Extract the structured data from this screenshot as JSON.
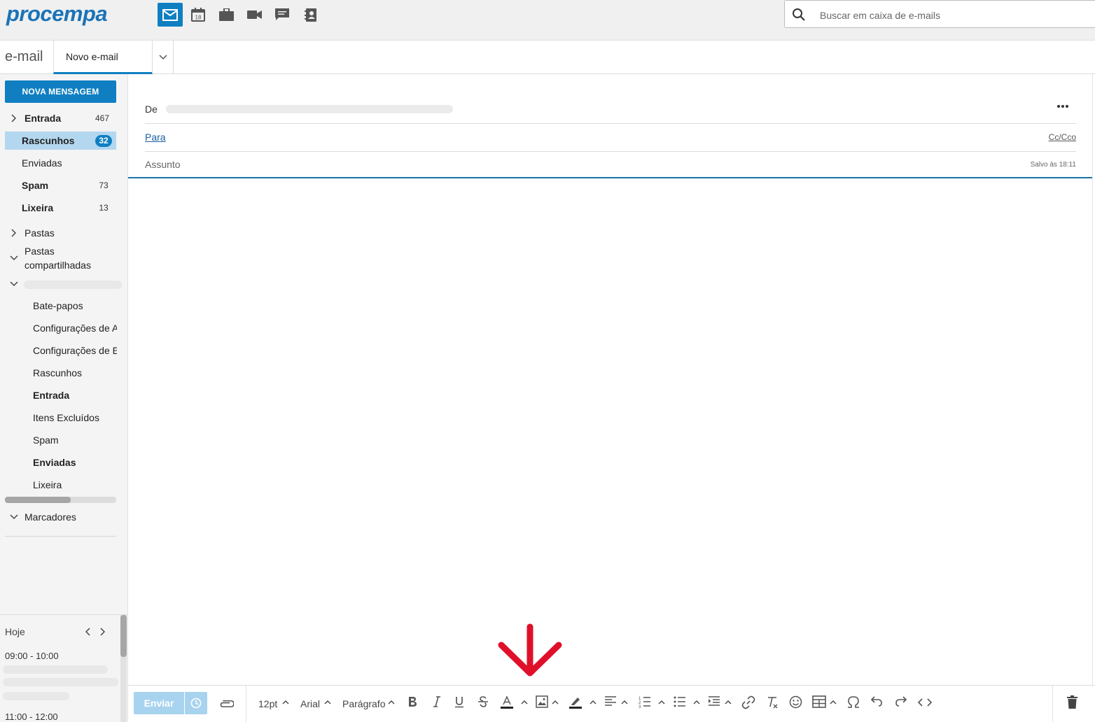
{
  "header": {
    "logo": "procempa",
    "apps": [
      {
        "name": "mail-icon",
        "active": true
      },
      {
        "name": "calendar-icon",
        "badge": "18"
      },
      {
        "name": "briefcase-icon"
      },
      {
        "name": "video-icon"
      },
      {
        "name": "chat-icon"
      },
      {
        "name": "contacts-icon"
      }
    ],
    "search_placeholder": "Buscar em caixa de e-mails"
  },
  "tabbar": {
    "section": "e-mail",
    "tab_label": "Novo e-mail"
  },
  "sidebar": {
    "new_message": "NOVA MENSAGEM",
    "folders": [
      {
        "label": "Entrada",
        "count": "467"
      },
      {
        "label": "Rascunhos",
        "count": "32"
      },
      {
        "label": "Enviadas"
      },
      {
        "label": "Spam",
        "count": "73"
      },
      {
        "label": "Lixeira",
        "count": "13"
      }
    ],
    "pastas": "Pastas",
    "shared_line1": "Pastas",
    "shared_line2": "compartilhadas",
    "shared_sub": [
      {
        "label": "Bate-papos"
      },
      {
        "label": "Configurações de A"
      },
      {
        "label": "Configurações de E"
      },
      {
        "label": "Rascunhos"
      },
      {
        "label": "Entrada"
      },
      {
        "label": "Itens Excluídos"
      },
      {
        "label": "Spam"
      },
      {
        "label": "Enviadas"
      },
      {
        "label": "Lixeira"
      }
    ],
    "marcadores": "Marcadores",
    "calendar": {
      "today": "Hoje",
      "slot1": "09:00 - 10:00",
      "slot2": "11:00 - 12:00"
    }
  },
  "compose": {
    "from_label": "De",
    "to_label": "Para",
    "cc_label": "Cc/Cco",
    "subject_placeholder": "Assunto",
    "saved": "Salvo às 18:11"
  },
  "toolbar": {
    "send": "Enviar",
    "font_size": "12pt",
    "font_name": "Arial",
    "block_format": "Parágrafo"
  },
  "colors": {
    "accent": "#0f7fc2",
    "selected_folder": "#b3d7ef",
    "send_disabled": "#a8d3ef",
    "annotation_arrow": "#e0102a"
  }
}
